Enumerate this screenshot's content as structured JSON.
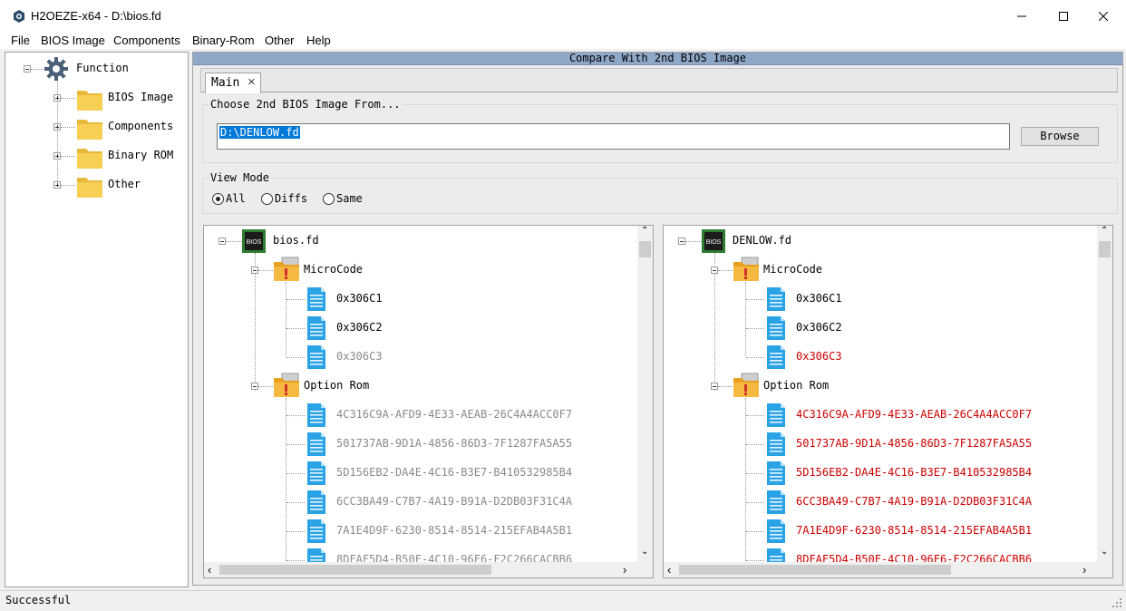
{
  "window": {
    "app": "H2OEZE-x64",
    "title": "H2OEZE-x64 - D:\\bios.fd"
  },
  "menu": [
    "File",
    "BIOS Image",
    "Components",
    "Binary-Rom",
    "Other",
    "Help"
  ],
  "sidebar": {
    "root": "Function",
    "items": [
      {
        "label": "BIOS Image",
        "icon": "folder-icon"
      },
      {
        "label": "Components",
        "icon": "folder-icon"
      },
      {
        "label": "Binary ROM",
        "icon": "folder-icon"
      },
      {
        "label": "Other",
        "icon": "folder-icon"
      }
    ]
  },
  "panel": {
    "caption": "Compare With 2nd BIOS Image"
  },
  "tabs": [
    {
      "label": "Main",
      "close": "×"
    }
  ],
  "choose": {
    "title": "Choose 2nd BIOS Image From...",
    "value": "D:\\DENLOW.fd",
    "browse": "Browse"
  },
  "view_mode": {
    "title": "View Mode",
    "options": [
      "All",
      "Diffs",
      "Same"
    ],
    "selected": "All"
  },
  "trees": {
    "left": {
      "root": "bios.fd",
      "microcode_label": "MicroCode",
      "microcode": [
        "0x306C1",
        "0x306C2",
        "0x306C3"
      ],
      "optionrom_label": "Option Rom",
      "optionrom": [
        "4C316C9A-AFD9-4E33-AEAB-26C4A4ACC0F7",
        "501737AB-9D1A-4856-86D3-7F1287FA5A55",
        "5D156EB2-DA4E-4C16-B3E7-B410532985B4",
        "6CC3BA49-C7B7-4A19-B91A-D2DB03F31C4A",
        "7A1E4D9F-6230-8514-8514-215EFAB4A5B1",
        "8DFAF5D4-B50F-4C10-96F6-F2C266CACBB6"
      ]
    },
    "right": {
      "root": "DENLOW.fd",
      "microcode_label": "MicroCode",
      "microcode": [
        "0x306C1",
        "0x306C2",
        "0x306C3"
      ],
      "optionrom_label": "Option Rom",
      "optionrom": [
        "4C316C9A-AFD9-4E33-AEAB-26C4A4ACC0F7",
        "501737AB-9D1A-4856-86D3-7F1287FA5A55",
        "5D156EB2-DA4E-4C16-B3E7-B410532985B4",
        "6CC3BA49-C7B7-4A19-B91A-D2DB03F31C4A",
        "7A1E4D9F-6230-8514-8514-215EFAB4A5B1",
        "8DFAF5D4-B50F-4C10-96F6-F2C266CACBB6"
      ]
    }
  },
  "colors": {
    "same": "#000000",
    "dim": "#8a8a8a",
    "diff": "#cc0000",
    "caption": "#8fa8c8",
    "selection": "#0078d7"
  },
  "status": "Successful"
}
